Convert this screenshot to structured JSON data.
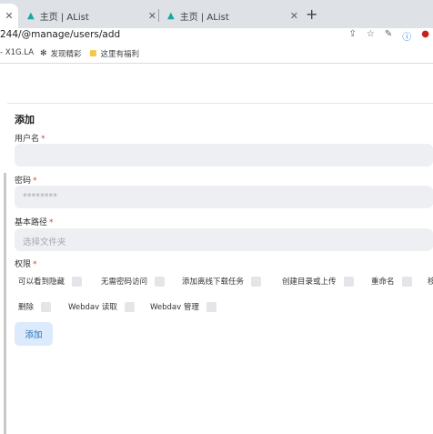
{
  "browser": {
    "tabs": [
      {
        "label": "",
        "close": "✕"
      },
      {
        "label": "主页 | AList",
        "close": "✕"
      },
      {
        "label": "主页 | AList",
        "close": "✕"
      }
    ],
    "new_tab": "+",
    "url": "244/@manage/users/add",
    "bookmarks": [
      {
        "label": "- X1G.LA"
      },
      {
        "label": "发现精彩"
      },
      {
        "label": "这里有福利"
      }
    ]
  },
  "form": {
    "title": "添加",
    "username_label": "用户名",
    "password_label": "密码",
    "password_value": "********",
    "base_path_label": "基本路径",
    "base_path_placeholder": "选择文件夹",
    "permissions_label": "权限",
    "required_mark": "*",
    "permissions": [
      {
        "label": "可以看到隐藏",
        "checked": false
      },
      {
        "label": "无需密码访问",
        "checked": false
      },
      {
        "label": "添加离线下载任务",
        "checked": false
      },
      {
        "label": "创建目录或上传",
        "checked": false
      },
      {
        "label": "重命名",
        "checked": false
      },
      {
        "label": "移",
        "checked": false
      },
      {
        "label": "删除",
        "checked": false
      },
      {
        "label": "Webdav 读取",
        "checked": false
      },
      {
        "label": "Webdav 管理",
        "checked": false
      }
    ],
    "submit_label": "添加"
  },
  "colors": {
    "accent": "#2b6cb0",
    "button_bg": "#dbeafc",
    "input_bg": "#edeff2",
    "required": "#e53935"
  },
  "icons": [
    "alist-logo-icon",
    "share-icon",
    "star-icon",
    "extension-icon",
    "info-icon",
    "profile-icon",
    "folder-icon"
  ]
}
